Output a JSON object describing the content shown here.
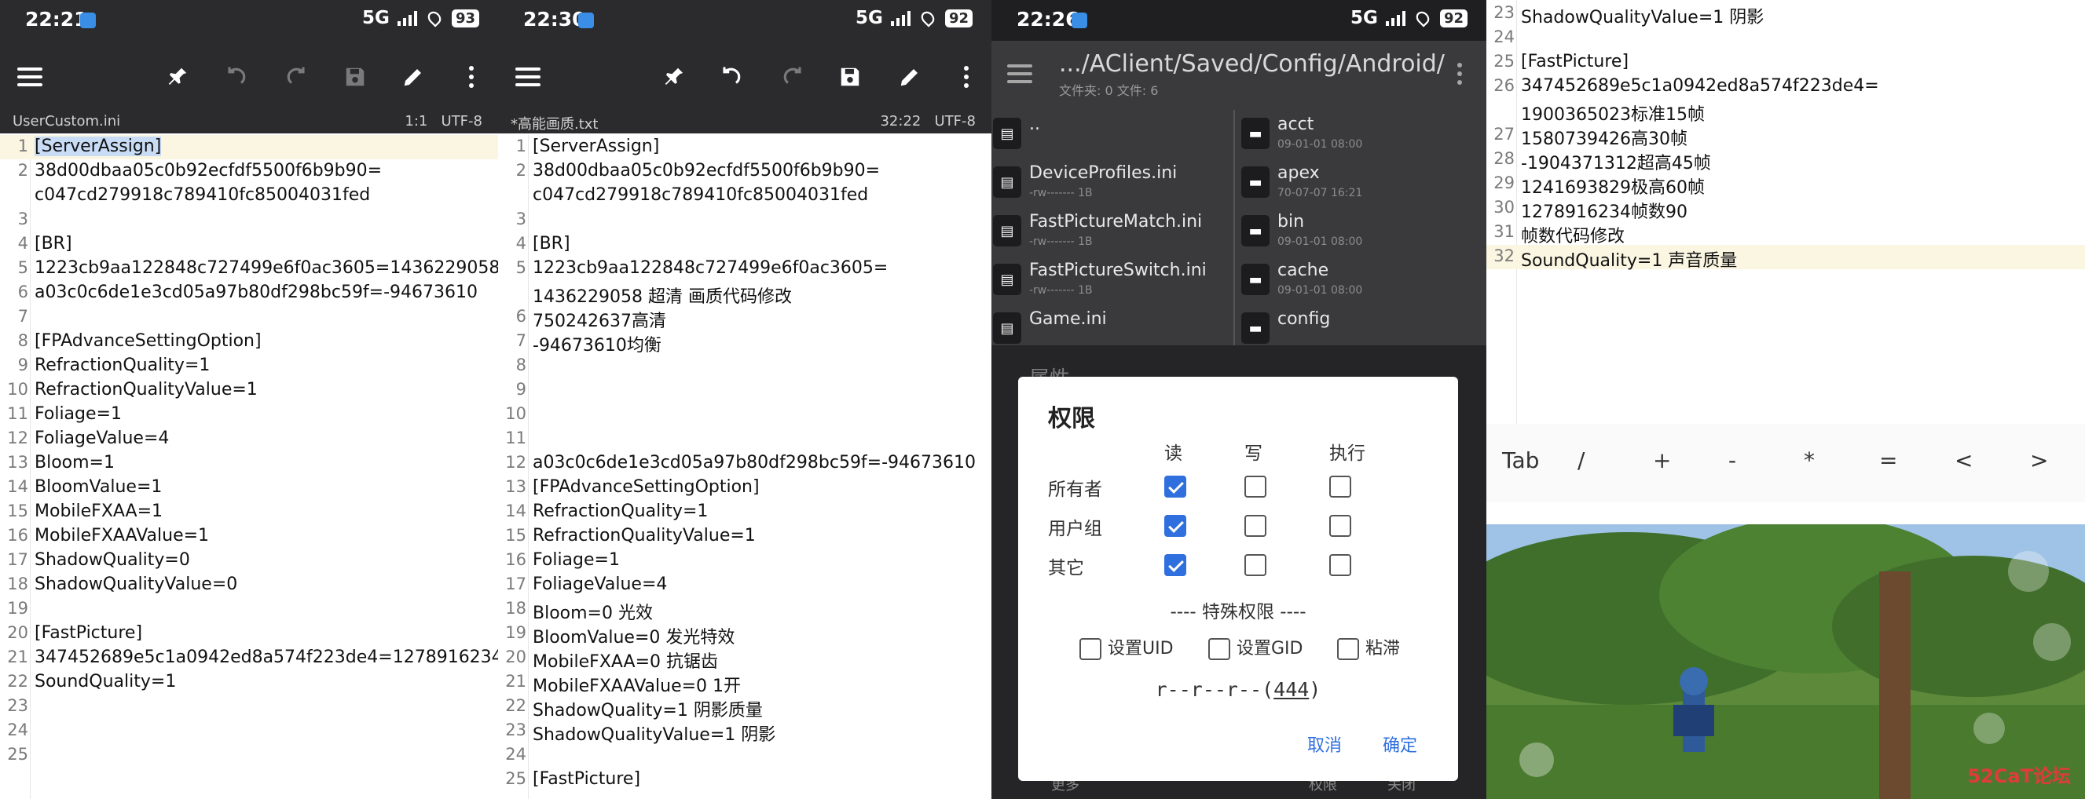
{
  "panel1": {
    "status": {
      "time": "22:21",
      "network": "5G",
      "battery": "93"
    },
    "filename": "UserCustom.ini",
    "position": "1:1",
    "encoding": "UTF-8",
    "lines": [
      {
        "n": "1",
        "text": "[ServerAssign]"
      },
      {
        "n": "2",
        "text": "38d00dbaa05c0b92ecfdf5500f6b9b90="
      },
      {
        "n": "",
        "text": "c047cd279918c789410fc85004031fed"
      },
      {
        "n": "3",
        "text": ""
      },
      {
        "n": "4",
        "text": "[BR]"
      },
      {
        "n": "5",
        "text": "1223cb9aa122848c727499e6f0ac3605=1436229058"
      },
      {
        "n": "6",
        "text": "a03c0c6de1e3cd05a97b80df298bc59f=-94673610"
      },
      {
        "n": "7",
        "text": ""
      },
      {
        "n": "8",
        "text": "[FPAdvanceSettingOption]"
      },
      {
        "n": "9",
        "text": "RefractionQuality=1"
      },
      {
        "n": "10",
        "text": "RefractionQualityValue=1"
      },
      {
        "n": "11",
        "text": "Foliage=1"
      },
      {
        "n": "12",
        "text": "FoliageValue=4"
      },
      {
        "n": "13",
        "text": "Bloom=1"
      },
      {
        "n": "14",
        "text": "BloomValue=1"
      },
      {
        "n": "15",
        "text": "MobileFXAA=1"
      },
      {
        "n": "16",
        "text": "MobileFXAAValue=1"
      },
      {
        "n": "17",
        "text": "ShadowQuality=0"
      },
      {
        "n": "18",
        "text": "ShadowQualityValue=0"
      },
      {
        "n": "19",
        "text": ""
      },
      {
        "n": "20",
        "text": "[FastPicture]"
      },
      {
        "n": "21",
        "text": "347452689e5c1a0942ed8a574f223de4=1278916234"
      },
      {
        "n": "22",
        "text": "SoundQuality=1"
      },
      {
        "n": "23",
        "text": ""
      },
      {
        "n": "24",
        "text": ""
      },
      {
        "n": "25",
        "text": ""
      }
    ]
  },
  "panel2": {
    "status": {
      "time": "22:30",
      "network": "5G",
      "battery": "92"
    },
    "filename": "*高能画质.txt",
    "position": "32:22",
    "encoding": "UTF-8",
    "lines": [
      {
        "n": "1",
        "text": "[ServerAssign]"
      },
      {
        "n": "2",
        "text": "38d00dbaa05c0b92ecfdf5500f6b9b90="
      },
      {
        "n": "",
        "text": "c047cd279918c789410fc85004031fed"
      },
      {
        "n": "3",
        "text": ""
      },
      {
        "n": "4",
        "text": "[BR]"
      },
      {
        "n": "5",
        "text": "1223cb9aa122848c727499e6f0ac3605="
      },
      {
        "n": "",
        "text": "1436229058      超清         画质代码修改"
      },
      {
        "n": "6",
        "text": "750242637高清"
      },
      {
        "n": "7",
        "text": "-94673610均衡"
      },
      {
        "n": "8",
        "text": ""
      },
      {
        "n": "9",
        "text": ""
      },
      {
        "n": "10",
        "text": ""
      },
      {
        "n": "11",
        "text": ""
      },
      {
        "n": "12",
        "text": "a03c0c6de1e3cd05a97b80df298bc59f=-94673610"
      },
      {
        "n": "13",
        "text": "[FPAdvanceSettingOption]"
      },
      {
        "n": "14",
        "text": "RefractionQuality=1"
      },
      {
        "n": "15",
        "text": "RefractionQualityValue=1"
      },
      {
        "n": "16",
        "text": "Foliage=1"
      },
      {
        "n": "17",
        "text": "FoliageValue=4"
      },
      {
        "n": "18",
        "text": "Bloom=0        光效"
      },
      {
        "n": "19",
        "text": "BloomValue=0     发光特效"
      },
      {
        "n": "20",
        "text": "MobileFXAA=0          抗锯齿"
      },
      {
        "n": "21",
        "text": "MobileFXAAValue=0     1开"
      },
      {
        "n": "22",
        "text": "ShadowQuality=1   阴影质量"
      },
      {
        "n": "23",
        "text": "ShadowQualityValue=1    阴影"
      },
      {
        "n": "24",
        "text": ""
      },
      {
        "n": "25",
        "text": "[FastPicture]"
      }
    ]
  },
  "panel3": {
    "status": {
      "time": "22:26",
      "network": "5G",
      "battery": "92"
    },
    "path": ".../AClient/Saved/Config/Android/",
    "counts": "文件夹: 0  文件: 6",
    "left_files": [
      {
        "name": "..",
        "meta": ""
      },
      {
        "name": "DeviceProfiles.ini",
        "meta": "-rw------- 1B"
      },
      {
        "name": "FastPictureMatch.ini",
        "meta": "-rw------- 1B"
      },
      {
        "name": "FastPictureSwitch.ini",
        "meta": "-rw------- 1B"
      },
      {
        "name": "Game.ini",
        "meta": ""
      }
    ],
    "right_files": [
      {
        "name": "acct",
        "meta": "09-01-01 08:00"
      },
      {
        "name": "apex",
        "meta": "70-07-07 16:21"
      },
      {
        "name": "bin",
        "meta": "09-01-01 08:00"
      },
      {
        "name": "cache",
        "meta": "09-01-01 08:00"
      },
      {
        "name": "config",
        "meta": ""
      }
    ],
    "behind_dialog_title": "属性",
    "behind_buttons": [
      "更多",
      "权限",
      "关闭"
    ],
    "dialog": {
      "title": "权限",
      "columns": [
        "读",
        "写",
        "执行"
      ],
      "rows": [
        {
          "label": "所有者",
          "checks": [
            true,
            false,
            false
          ]
        },
        {
          "label": "用户组",
          "checks": [
            true,
            false,
            false
          ]
        },
        {
          "label": "其它",
          "checks": [
            true,
            false,
            false
          ]
        }
      ],
      "special_title": "---- 特殊权限 ----",
      "special": [
        "设置UID",
        "设置GID",
        "粘滞"
      ],
      "perm_prefix": "r--r--r--(",
      "perm_octal": "444",
      "perm_suffix": ")",
      "cancel": "取消",
      "ok": "确定"
    }
  },
  "panel4": {
    "lines": [
      {
        "n": "23",
        "text": "ShadowQualityValue=1    阴影"
      },
      {
        "n": "24",
        "text": ""
      },
      {
        "n": "25",
        "text": "[FastPicture]"
      },
      {
        "n": "26",
        "text": "347452689e5c1a0942ed8a574f223de4="
      },
      {
        "n": "",
        "text": "1900365023标准15帧"
      },
      {
        "n": "27",
        "text": "1580739426高30帧"
      },
      {
        "n": "28",
        "text": "-1904371312超高45帧"
      },
      {
        "n": "29",
        "text": "1241693829极高60帧"
      },
      {
        "n": "30",
        "text": "1278916234帧数90"
      },
      {
        "n": "31",
        "text": "帧数代码修改"
      },
      {
        "n": "32",
        "text": "SoundQuality=1   声音质量"
      }
    ],
    "keys": [
      "Tab",
      "/",
      "+",
      "-",
      "*",
      "=",
      "<",
      ">"
    ],
    "watermark": "52CaT论坛"
  },
  "colors": {
    "bar": "#2b2b2d",
    "accent": "#2f6fde",
    "current_line": "#fbf6e2"
  },
  "icons": [
    "menu-icon",
    "pin-icon",
    "undo-icon",
    "redo-icon",
    "save-icon",
    "edit-icon",
    "more-icon",
    "file-icon",
    "folder-icon"
  ]
}
